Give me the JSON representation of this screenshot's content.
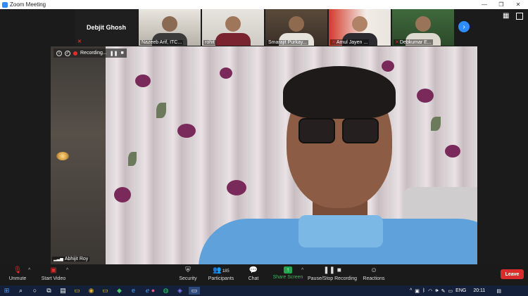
{
  "window": {
    "title": "Zoom Meeting",
    "minimize": "—",
    "restore": "❐",
    "close": "✕"
  },
  "gallery": {
    "tiles": [
      {
        "name": "Debjit Ghosh",
        "muted": true,
        "video": false
      },
      {
        "name": "Nazeeb Arif, ITC...",
        "muted": false,
        "video": true
      },
      {
        "name": "rohit",
        "muted": false,
        "video": true
      },
      {
        "name": "Smarajit Purkay...",
        "muted": false,
        "video": true
      },
      {
        "name": "Amul Jayen ...",
        "muted": true,
        "video": true
      },
      {
        "name": "Debkumar E...",
        "muted": true,
        "video": true
      }
    ],
    "next_icon": "›"
  },
  "view_controls": {
    "grid_icon": "▦"
  },
  "recording": {
    "label": "Recording...",
    "pause": "❚❚",
    "stop": "■"
  },
  "speaker": {
    "name": "Abhijit Roy"
  },
  "toolbar": {
    "unmute": "Unmute",
    "start_video": "Start Video",
    "security": "Security",
    "participants": "Participants",
    "participants_count": "185",
    "chat": "Chat",
    "share_screen": "Share Screen",
    "pause_stop": "Pause/Stop Recording",
    "reactions": "Reactions",
    "leave": "Leave"
  },
  "taskbar": {
    "language": "ENG",
    "time": "20:11"
  },
  "colors": {
    "accent_blue": "#2d8cff",
    "leave_red": "#d92d2d",
    "share_green": "#1fa84f",
    "taskbar": "#14203a"
  }
}
